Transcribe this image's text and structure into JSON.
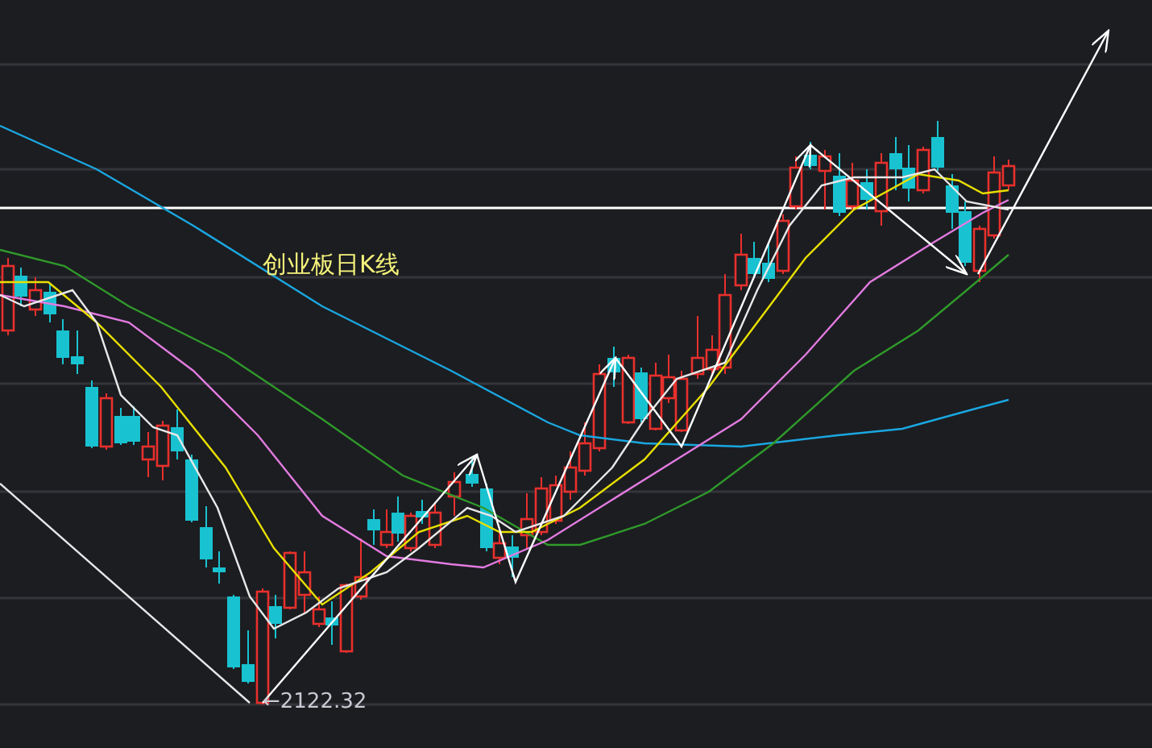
{
  "chart": {
    "title": "创业板日K线",
    "low_label": "←2122.32"
  }
}
